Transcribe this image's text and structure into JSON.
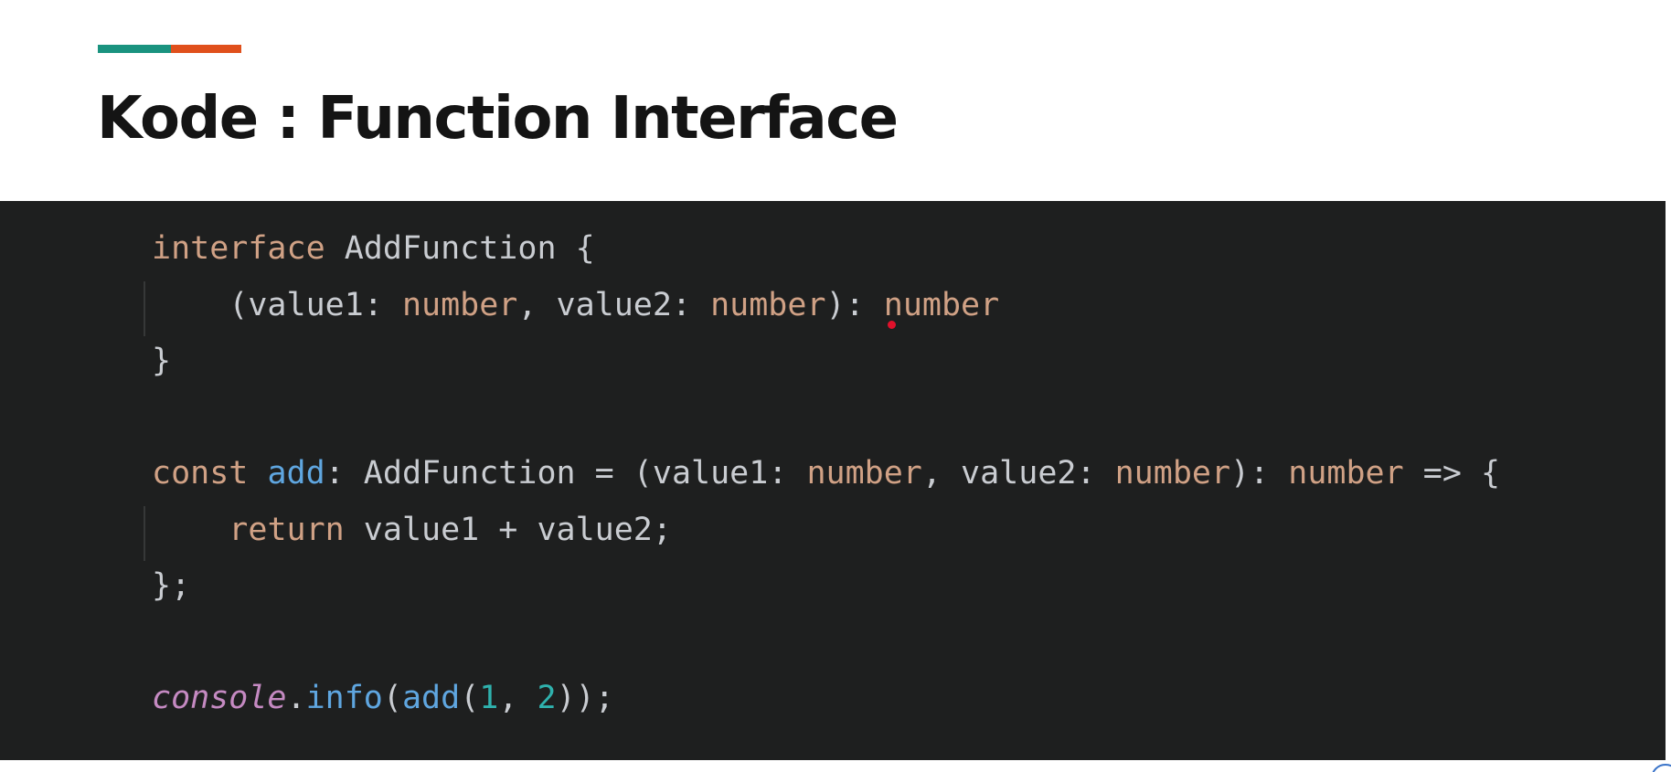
{
  "slide": {
    "title": "Kode : Function Interface",
    "accent_colors": [
      "#1a937f",
      "#e0501c"
    ]
  },
  "code": {
    "language": "typescript",
    "colors": {
      "keyword": "#d0a185",
      "function": "#5fa6e0",
      "number_literal": "#2fb1ad",
      "object": "#c58ac2",
      "plain": "#c9ccd1",
      "background": "#1e1f1f"
    },
    "lines": [
      [
        {
          "t": "interface",
          "c": "kw"
        },
        {
          "t": " AddFunction {",
          "c": "plain"
        }
      ],
      [
        {
          "t": "    (value1: ",
          "c": "plain"
        },
        {
          "t": "number",
          "c": "kw"
        },
        {
          "t": ", value2: ",
          "c": "plain"
        },
        {
          "t": "number",
          "c": "kw"
        },
        {
          "t": "): ",
          "c": "plain"
        },
        {
          "t": "number",
          "c": "kw"
        }
      ],
      [
        {
          "t": "}",
          "c": "plain"
        }
      ],
      [],
      [
        {
          "t": "const",
          "c": "kw"
        },
        {
          "t": " ",
          "c": "plain"
        },
        {
          "t": "add",
          "c": "fn"
        },
        {
          "t": ": AddFunction = (value1: ",
          "c": "plain"
        },
        {
          "t": "number",
          "c": "kw"
        },
        {
          "t": ", value2: ",
          "c": "plain"
        },
        {
          "t": "number",
          "c": "kw"
        },
        {
          "t": "): ",
          "c": "plain"
        },
        {
          "t": "number",
          "c": "kw"
        },
        {
          "t": " => {",
          "c": "plain"
        }
      ],
      [
        {
          "t": "    ",
          "c": "plain"
        },
        {
          "t": "return",
          "c": "kw"
        },
        {
          "t": " value1 + value2;",
          "c": "plain"
        }
      ],
      [
        {
          "t": "};",
          "c": "plain"
        }
      ],
      [],
      [
        {
          "t": "console",
          "c": "obj"
        },
        {
          "t": ".",
          "c": "plain"
        },
        {
          "t": "info",
          "c": "fn"
        },
        {
          "t": "(",
          "c": "plain"
        },
        {
          "t": "add",
          "c": "fn"
        },
        {
          "t": "(",
          "c": "plain"
        },
        {
          "t": "1",
          "c": "num"
        },
        {
          "t": ", ",
          "c": "plain"
        },
        {
          "t": "2",
          "c": "num"
        },
        {
          "t": "));",
          "c": "plain"
        }
      ]
    ],
    "indent_guides_on_lines": [
      1,
      5
    ]
  }
}
